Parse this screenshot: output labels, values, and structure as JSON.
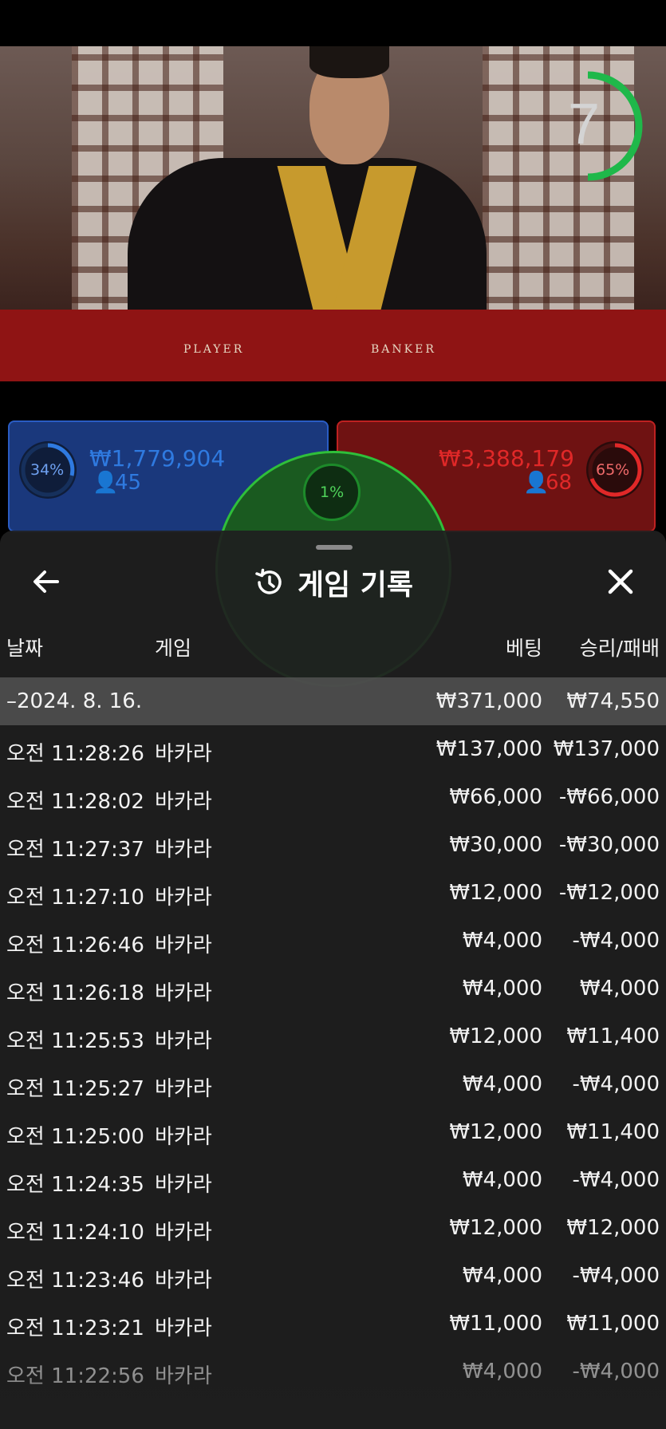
{
  "game": {
    "timer": "7",
    "table_labels": {
      "player": "PLAYER",
      "banker": "BANKER"
    },
    "player": {
      "percent": "34%",
      "amount": "₩1,779,904",
      "count": "45"
    },
    "banker": {
      "percent": "65%",
      "amount": "₩3,388,179",
      "count": "68"
    },
    "tie": {
      "percent": "1%"
    },
    "colors": {
      "player": "#2f66d9",
      "banker": "#d32525",
      "tie": "#2fbf3a",
      "timer": "#1fb84a"
    }
  },
  "panel": {
    "title": "게임 기록",
    "icons": {
      "back": "arrow-left-icon",
      "history": "history-icon",
      "close": "close-icon"
    },
    "headers": {
      "date": "날짜",
      "game": "게임",
      "bet": "베팅",
      "result": "승리/패배"
    },
    "summary": {
      "date": "–2024. 8. 16.",
      "bet": "₩371,000",
      "result": "₩74,550"
    },
    "rows": [
      {
        "time": "오전 11:28:26",
        "game": "바카라",
        "bet": "₩137,000",
        "result": "₩137,000"
      },
      {
        "time": "오전 11:28:02",
        "game": "바카라",
        "bet": "₩66,000",
        "result": "-₩66,000"
      },
      {
        "time": "오전 11:27:37",
        "game": "바카라",
        "bet": "₩30,000",
        "result": "-₩30,000"
      },
      {
        "time": "오전 11:27:10",
        "game": "바카라",
        "bet": "₩12,000",
        "result": "-₩12,000"
      },
      {
        "time": "오전 11:26:46",
        "game": "바카라",
        "bet": "₩4,000",
        "result": "-₩4,000"
      },
      {
        "time": "오전 11:26:18",
        "game": "바카라",
        "bet": "₩4,000",
        "result": "₩4,000"
      },
      {
        "time": "오전 11:25:53",
        "game": "바카라",
        "bet": "₩12,000",
        "result": "₩11,400"
      },
      {
        "time": "오전 11:25:27",
        "game": "바카라",
        "bet": "₩4,000",
        "result": "-₩4,000"
      },
      {
        "time": "오전 11:25:00",
        "game": "바카라",
        "bet": "₩12,000",
        "result": "₩11,400"
      },
      {
        "time": "오전 11:24:35",
        "game": "바카라",
        "bet": "₩4,000",
        "result": "-₩4,000"
      },
      {
        "time": "오전 11:24:10",
        "game": "바카라",
        "bet": "₩12,000",
        "result": "₩12,000"
      },
      {
        "time": "오전 11:23:46",
        "game": "바카라",
        "bet": "₩4,000",
        "result": "-₩4,000"
      },
      {
        "time": "오전 11:23:21",
        "game": "바카라",
        "bet": "₩11,000",
        "result": "₩11,000"
      },
      {
        "time": "오전 11:22:56",
        "game": "바카라",
        "bet": "₩4,000",
        "result": "-₩4,000"
      }
    ]
  }
}
